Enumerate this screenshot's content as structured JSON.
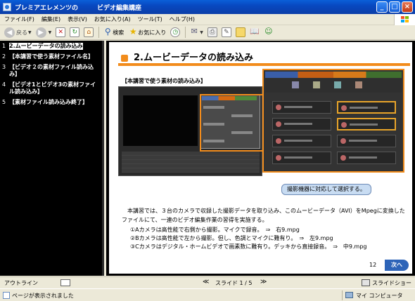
{
  "window": {
    "title": "プレミアエレメンツの　　　ビデオ編集講座"
  },
  "menu": [
    "ファイル(F)",
    "編集(E)",
    "表示(V)",
    "お気に入り(A)",
    "ツール(T)",
    "ヘルプ(H)"
  ],
  "toolbar": {
    "back_label": "戻る",
    "search_label": "検索",
    "favorites_label": "お気に入り"
  },
  "nav": [
    {
      "num": "1",
      "label": "2.ムービーデータの読み込み",
      "active": true
    },
    {
      "num": "2",
      "label": "【本講習で使う素材ファイル名】",
      "active": false
    },
    {
      "num": "3",
      "label": "【ビデオ２の素材ファイル読み込み】",
      "active": false
    },
    {
      "num": "4",
      "label": "【ビデオ1とビデオ3の素材ファイル読み込み】",
      "active": false
    },
    {
      "num": "5",
      "label": "【素材ファイル読み込み終了】",
      "active": false
    }
  ],
  "slide": {
    "title": "2.ムービーデータの読み込み",
    "subheading": "【本講習で使う素材の読み込み】",
    "callout": "撮影機器に対応して選択する。",
    "paragraph": "　本講習では、３台のカメラで収録した撮影データを取り込み、このムービーデータ（AVI）をMpegに変換したファイルにて、一連のビデオ編集作業の習得を実施する。",
    "items": [
      "①Aカメラは高性能で右側から撮影。マイクで録音。　⇒　右9.mpg",
      "②Bカメラは高性能で左から撮影。但し、色調とマイクに難有り。　⇒　左9.mpg",
      "③Cカメラはデジタル・ホームビデオで画素数に難有り。デッキから直接録音。　⇒　中9.mpg"
    ],
    "page_number": "12",
    "next_label": "次へ"
  },
  "controls": {
    "outline_label": "アウトライン",
    "prev_symbol": "≪",
    "slide_counter": "スライド 1 / 5",
    "next_symbol": "≫",
    "slideshow_label": "スライドショー"
  },
  "status": {
    "text": "ページが表示されました",
    "zone": "マイ コンピュータ"
  }
}
